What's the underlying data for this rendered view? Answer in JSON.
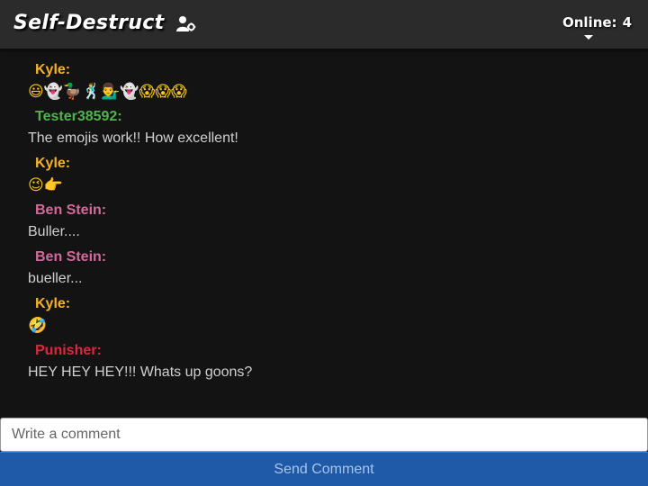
{
  "header": {
    "title": "Self-Destruct",
    "settings_icon": "user-cog-icon",
    "online_label": "Online:",
    "online_count": "4",
    "dropdown_icon": "caret-down-icon"
  },
  "messages": [
    {
      "author": "Kyle:",
      "author_color": "#f5b324",
      "text": "😃👻🦆🕺💁‍♂️👻😱😱😱",
      "is_emoji": true
    },
    {
      "author": "Tester38592:",
      "author_color": "#4fb54a",
      "text": "The emojis work!! How excellent!",
      "is_emoji": false
    },
    {
      "author": "Kyle:",
      "author_color": "#f5b324",
      "text": "😉👉",
      "is_emoji": true
    },
    {
      "author": "Ben Stein:",
      "author_color": "#d36a9a",
      "text": "Buller....",
      "is_emoji": false
    },
    {
      "author": "Ben Stein:",
      "author_color": "#d36a9a",
      "text": "bueller...",
      "is_emoji": false
    },
    {
      "author": "Kyle:",
      "author_color": "#f5b324",
      "text": "🤣",
      "is_emoji": true
    },
    {
      "author": "Punisher:",
      "author_color": "#e0263e",
      "text": "HEY HEY HEY!!! Whats up goons?",
      "is_emoji": false
    }
  ],
  "composer": {
    "placeholder": "Write a comment",
    "value": "",
    "send_label": "Send Comment"
  },
  "colors": {
    "background": "#131313",
    "header_bg": "#2b2b2b",
    "send_button_bg": "#1e5aa8",
    "send_button_text": "#a9c4e8"
  }
}
